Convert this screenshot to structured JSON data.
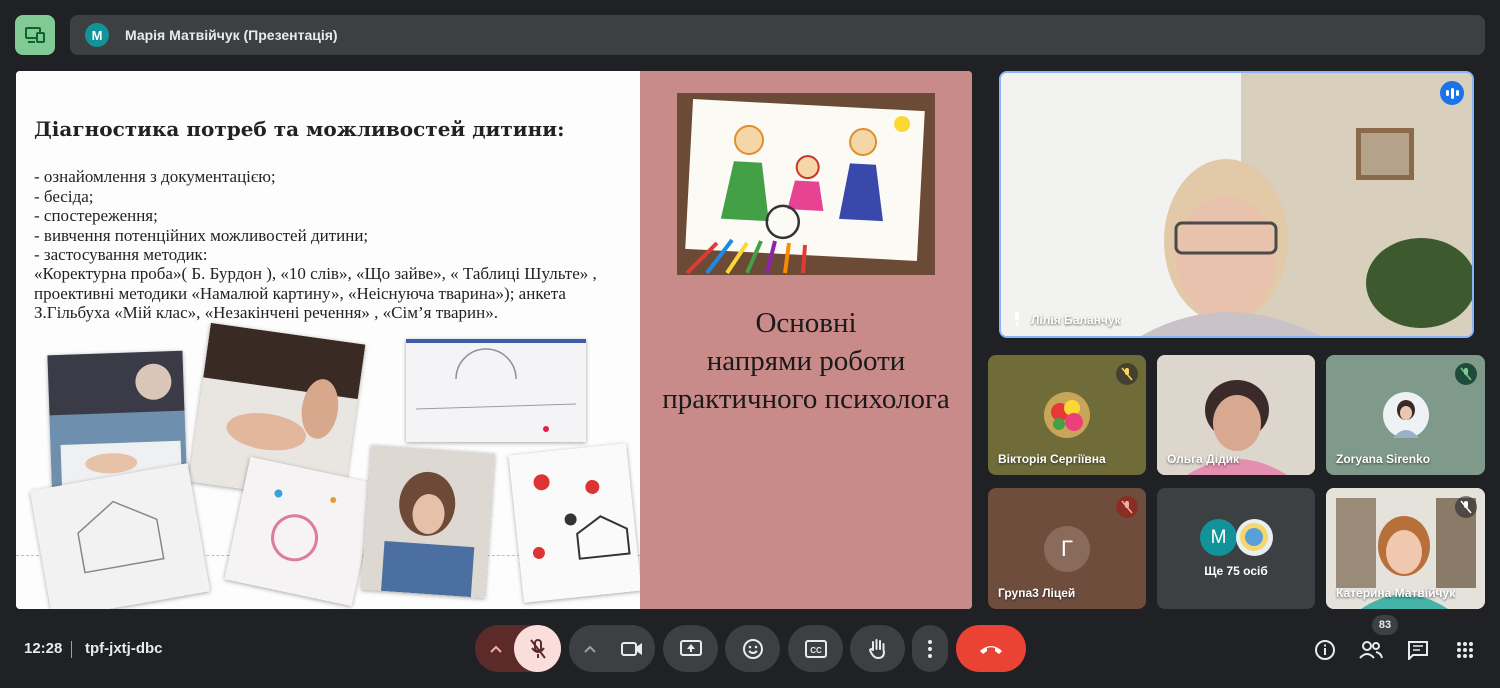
{
  "presenter": {
    "initial": "M",
    "name": "Марія Матвійчук (Презентація)"
  },
  "slide": {
    "title": "Діагностика потреб та можливостей дитини:",
    "items": [
      "- ознайомлення з документацією;",
      "- бесіда;",
      "- спостереження;",
      "- вивчення потенційних можливостей дитини;",
      "- застосування методик:"
    ],
    "methods": "«Коректурна проба»( Б. Бурдон ), «10 слів», «Що зайве», « Таблиці Шульте» , проективні методики «Намалюй картину», «Неіснуюча тварина»); анкета З.Гільбуха «Мій клас», «Незакінчені речення» , «Сім’я тварин».",
    "right_title_line1": "Основні",
    "right_title_line2": "напрями роботи",
    "right_title_line3": "практичного психолога"
  },
  "participants": {
    "main": {
      "name": "Лілія Баланчук"
    },
    "tiles": [
      {
        "name": "Вікторія Сергіївна",
        "muted": true
      },
      {
        "name": "Ольга Дідик",
        "muted": false
      },
      {
        "name": "Zoryana Sirenko",
        "muted": true
      },
      {
        "name": "Група3 Ліцей",
        "initial": "Г",
        "muted": true
      },
      {
        "name": "Ще 75 осіб",
        "initial": "M"
      },
      {
        "name": "Катерина Матвійчук",
        "muted": true
      }
    ]
  },
  "bottombar": {
    "time": "12:28",
    "meeting_code": "tpf-jxtj-dbc",
    "people_count": "83"
  },
  "colors": {
    "accent_blue": "#8ab4f8",
    "hangup_red": "#ea4335",
    "present_green": "#81c995",
    "mic_off_bg": "#fad2cf"
  }
}
